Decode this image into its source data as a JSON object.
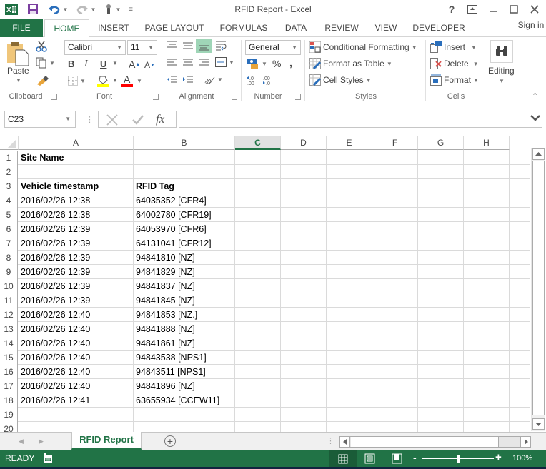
{
  "window": {
    "title": "RFID Report - Excel",
    "help": "?",
    "sign_in": "Sign in"
  },
  "tabs": [
    {
      "label": "FILE"
    },
    {
      "label": "HOME"
    },
    {
      "label": "INSERT"
    },
    {
      "label": "PAGE LAYOUT"
    },
    {
      "label": "FORMULAS"
    },
    {
      "label": "DATA"
    },
    {
      "label": "REVIEW"
    },
    {
      "label": "VIEW"
    },
    {
      "label": "DEVELOPER"
    }
  ],
  "ribbon": {
    "clipboard": {
      "label": "Clipboard",
      "paste": "Paste"
    },
    "font": {
      "label": "Font",
      "name": "Calibri",
      "size": "11",
      "bold": "B",
      "italic": "I",
      "underline": "U",
      "highlight_color": "#ffff00",
      "font_color": "#ff0000"
    },
    "alignment": {
      "label": "Alignment"
    },
    "number": {
      "label": "Number",
      "format": "General",
      "percent": "%",
      "comma": ","
    },
    "styles": {
      "label": "Styles",
      "conditional": "Conditional Formatting",
      "format_table": "Format as Table",
      "cell_styles": "Cell Styles"
    },
    "cells": {
      "label": "Cells",
      "insert": "Insert",
      "delete": "Delete",
      "format": "Format"
    },
    "editing": {
      "label": "Editing"
    }
  },
  "formula_bar": {
    "name_box": "C23",
    "fx": "fx",
    "value": ""
  },
  "grid": {
    "columns": [
      "A",
      "B",
      "C",
      "D",
      "E",
      "F",
      "G",
      "H"
    ],
    "selected_column": "C",
    "rows": [
      {
        "n": "1",
        "a": "Site Name",
        "b": "",
        "bold": true
      },
      {
        "n": "2",
        "a": "",
        "b": ""
      },
      {
        "n": "3",
        "a": "Vehicle timestamp",
        "b": "RFID Tag",
        "bold": true
      },
      {
        "n": "4",
        "a": "2016/02/26 12:38",
        "b": "64035352 [CFR4]"
      },
      {
        "n": "5",
        "a": "2016/02/26 12:38",
        "b": "64002780 [CFR19]"
      },
      {
        "n": "6",
        "a": "2016/02/26 12:39",
        "b": "64053970 [CFR6]"
      },
      {
        "n": "7",
        "a": "2016/02/26 12:39",
        "b": "64131041 [CFR12]"
      },
      {
        "n": "8",
        "a": "2016/02/26 12:39",
        "b": "94841810 [NZ]"
      },
      {
        "n": "9",
        "a": "2016/02/26 12:39",
        "b": "94841829 [NZ]"
      },
      {
        "n": "10",
        "a": "2016/02/26 12:39",
        "b": "94841837 [NZ]"
      },
      {
        "n": "11",
        "a": "2016/02/26 12:39",
        "b": "94841845 [NZ]"
      },
      {
        "n": "12",
        "a": "2016/02/26 12:40",
        "b": "94841853 [NZ.]"
      },
      {
        "n": "13",
        "a": "2016/02/26 12:40",
        "b": "94841888 [NZ]"
      },
      {
        "n": "14",
        "a": "2016/02/26 12:40",
        "b": "94841861 [NZ]"
      },
      {
        "n": "15",
        "a": "2016/02/26 12:40",
        "b": "94843538 [NPS1]"
      },
      {
        "n": "16",
        "a": "2016/02/26 12:40",
        "b": "94843511 [NPS1]"
      },
      {
        "n": "17",
        "a": "2016/02/26 12:40",
        "b": "94841896 [NZ]"
      },
      {
        "n": "18",
        "a": "2016/02/26 12:41",
        "b": "63655934 [CCEW11]"
      },
      {
        "n": "19",
        "a": "",
        "b": ""
      },
      {
        "n": "20",
        "a": "",
        "b": ""
      }
    ]
  },
  "sheets": {
    "active": "RFID Report",
    "add_label": "+"
  },
  "status": {
    "state": "READY",
    "zoom": "100%",
    "zoom_fraction": 0.5
  },
  "colors": {
    "accent": "#217346",
    "taskbar": "#10253f"
  }
}
